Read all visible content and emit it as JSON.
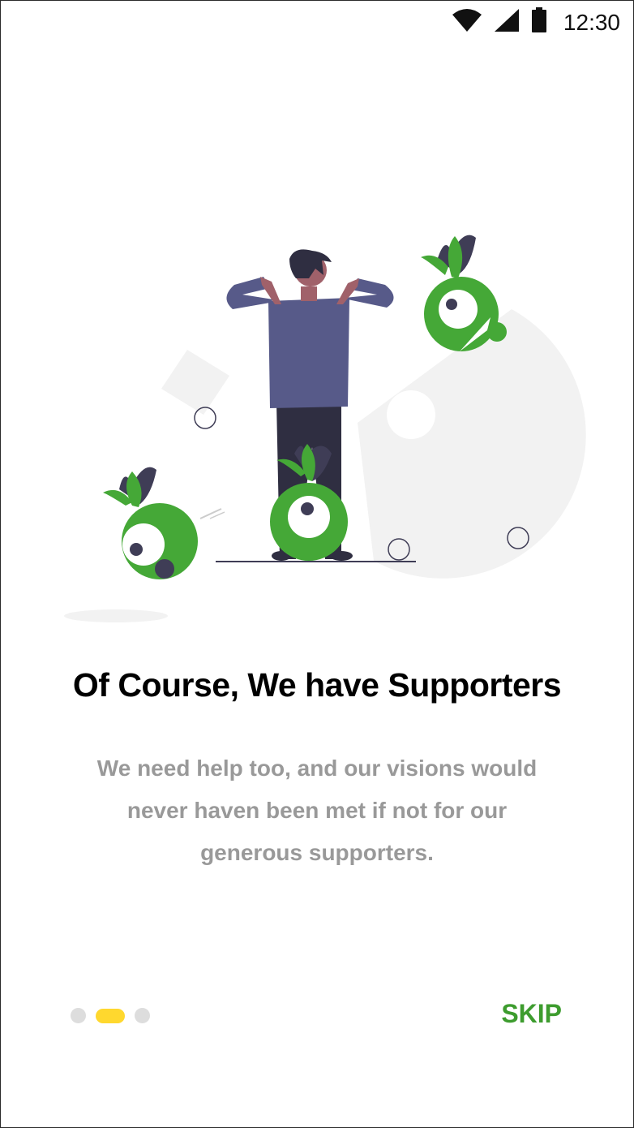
{
  "status_bar": {
    "time": "12:30",
    "icons": [
      "wifi-icon",
      "signal-icon",
      "battery-icon"
    ]
  },
  "onboarding": {
    "title": "Of Course, We have Supporters",
    "description": "We need help too, and our visions would never haven been met if not for our generous supporters.",
    "pager": {
      "count": 3,
      "active_index": 1
    },
    "skip_label": "SKIP"
  },
  "colors": {
    "accent_green": "#45a837",
    "skip_green": "#3d9c2e",
    "active_dot": "#ffd82e",
    "inactive_dot": "#dddddd",
    "title": "#000000",
    "description": "#999999"
  }
}
